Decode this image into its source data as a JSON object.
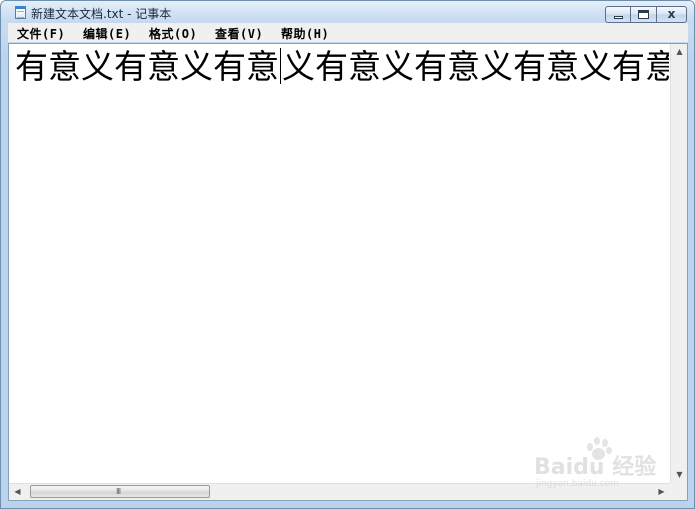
{
  "window": {
    "title": "新建文本文档.txt - 记事本",
    "controls": {
      "minimize": "",
      "maximize": "",
      "close": "x"
    }
  },
  "menu": {
    "items": [
      {
        "label": "文件(F)"
      },
      {
        "label": "编辑(E)"
      },
      {
        "label": "格式(O)"
      },
      {
        "label": "查看(V)"
      },
      {
        "label": "帮助(H)"
      }
    ]
  },
  "editor": {
    "text_before_caret": "有意义有意义有意",
    "text_after_caret": "义有意义有意义有意义有意义有"
  },
  "scrollbars": {
    "left_arrow": "◀",
    "right_arrow": "▶",
    "up_arrow": "▲",
    "down_arrow": "▼",
    "grip": "III"
  },
  "watermark": {
    "brand": "Baidu 经验",
    "url": "jingyan.baidu.com"
  },
  "colors": {
    "titlebar": "#cfe0f3",
    "menubar": "#f0f0f0",
    "editor_bg": "#ffffff"
  }
}
